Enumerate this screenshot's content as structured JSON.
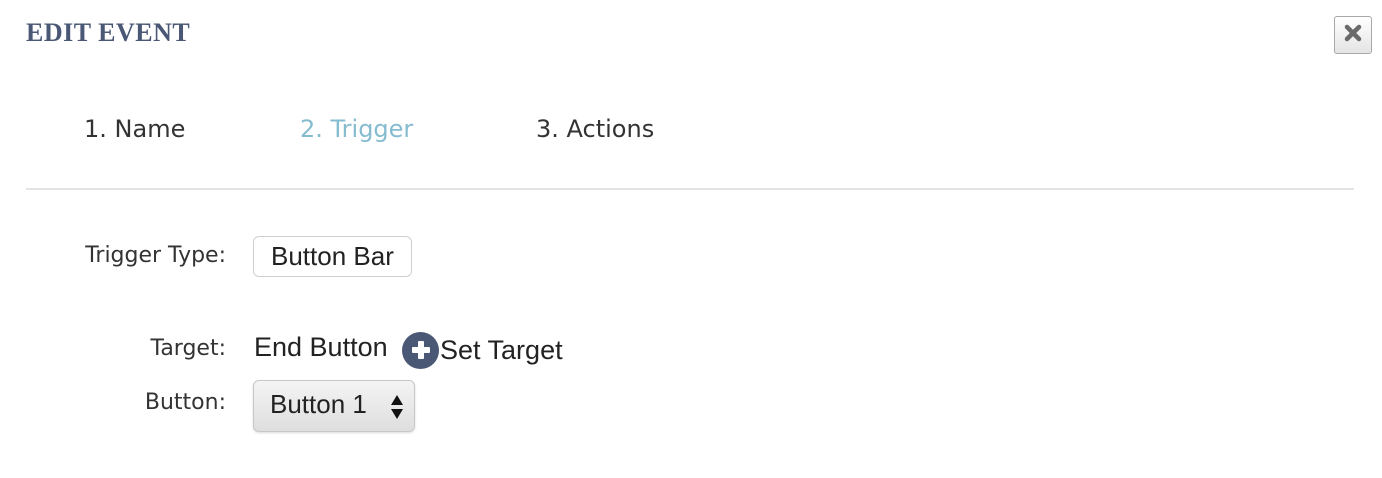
{
  "dialog": {
    "title": "EDIT EVENT",
    "close_icon": "close-x-icon"
  },
  "tabs": [
    {
      "label": "1. Name",
      "active": false
    },
    {
      "label": "2. Trigger",
      "active": true
    },
    {
      "label": "3. Actions",
      "active": false
    }
  ],
  "form": {
    "trigger_type_label": "Trigger Type:",
    "trigger_type_value": "Button Bar",
    "target_label": "Target:",
    "target_value": "End Button",
    "set_target_label": "Set Target",
    "set_target_icon": "plus-circle-icon",
    "button_label": "Button:",
    "button_selected": "Button 1"
  },
  "colors": {
    "title": "#4a5875",
    "active_tab": "#86bcd0",
    "plus_icon": "#4a5875",
    "divider": "#e4e4e4"
  }
}
